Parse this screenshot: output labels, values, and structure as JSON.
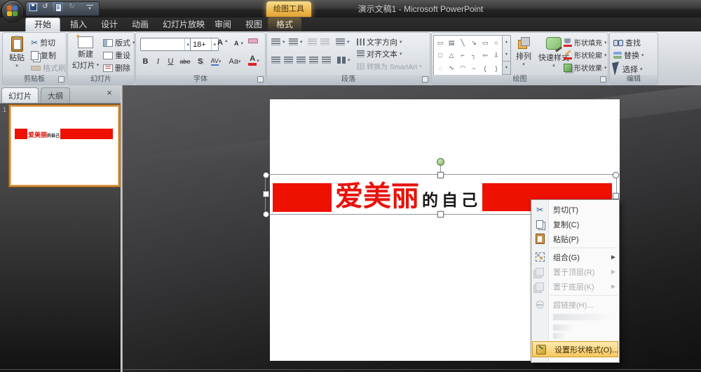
{
  "window": {
    "title": "演示文稿1 - Microsoft PowerPoint",
    "contextual_group": "绘图工具"
  },
  "ui": {
    "caret": "▾",
    "submenu_arrow": "▶",
    "close": "×",
    "scissors": "✂",
    "undo": "↺",
    "redo": "↻",
    "up": "▴",
    "down": "▾",
    "star": "*",
    "font_grow": "A",
    "font_shrink": "A"
  },
  "tabs": {
    "items": [
      "开始",
      "插入",
      "设计",
      "动画",
      "幻灯片放映",
      "审阅",
      "视图",
      "格式"
    ],
    "active": "开始"
  },
  "ribbon": {
    "clipboard": {
      "label": "剪贴板",
      "paste": "粘贴",
      "cut": "剪切",
      "copy": "复制",
      "format_painter": "格式刷"
    },
    "slides": {
      "label": "幻灯片",
      "new_slide_line1": "新建",
      "new_slide_line2": "幻灯片",
      "layout": "版式",
      "reset": "重设",
      "delete": "删除"
    },
    "font": {
      "label": "字体",
      "name_value": "",
      "size_value": "18+",
      "bold": "B",
      "italic": "I",
      "underline": "U",
      "strikethrough": "abe",
      "shadow": "S",
      "char_spacing": "AV",
      "change_case": "Aa",
      "font_color": "A"
    },
    "paragraph": {
      "label": "段落",
      "text_direction": "文字方向",
      "align_text": "对齐文本",
      "smartart": "转换为 SmartArt"
    },
    "drawing": {
      "label": "绘图",
      "arrange": "排列",
      "quick_styles": "快速样式",
      "shape_fill": "形状填充",
      "shape_outline": "形状轮廓",
      "shape_effects": "形状效果",
      "shapes": [
        "▭",
        "▤",
        "╲",
        "↘",
        "▭",
        "○",
        "□",
        "△",
        "⌐",
        "┐",
        "⇦",
        "⇩",
        "◌",
        "∿",
        "◠",
        "~",
        "{",
        "}"
      ]
    },
    "editing": {
      "label": "编辑",
      "find": "查找",
      "replace": "替换",
      "select": "选择"
    }
  },
  "panel": {
    "tab_slides": "幻灯片",
    "tab_outline": "大纲",
    "slide_number": "1"
  },
  "slide": {
    "red_text": "爱美丽",
    "black_text": "的自己"
  },
  "context_menu": {
    "items": [
      {
        "label": "剪切(T)",
        "icon": "scissors-icon",
        "enabled": true
      },
      {
        "label": "复制(C)",
        "icon": "copy-icon",
        "enabled": true
      },
      {
        "label": "粘贴(P)",
        "icon": "paste-icon",
        "enabled": true
      },
      {
        "label": "组合(G)",
        "icon": "group-icon",
        "enabled": true,
        "submenu": true
      },
      {
        "label": "置于顶层(R)",
        "icon": "bring-to-front-icon",
        "enabled": false,
        "submenu": true
      },
      {
        "label": "置于底层(K)",
        "icon": "send-to-back-icon",
        "enabled": false,
        "submenu": true
      },
      {
        "label": "超链接(H)...",
        "icon": "hyperlink-icon",
        "enabled": false
      },
      {
        "label": "设置形状格式(O)...",
        "icon": "format-shape-icon",
        "enabled": true,
        "highlighted": true
      }
    ]
  },
  "colors": {
    "accent_red": "#ee1000",
    "menu_highlight": "#f7c75f",
    "contextual_amber": "#eebb55"
  }
}
